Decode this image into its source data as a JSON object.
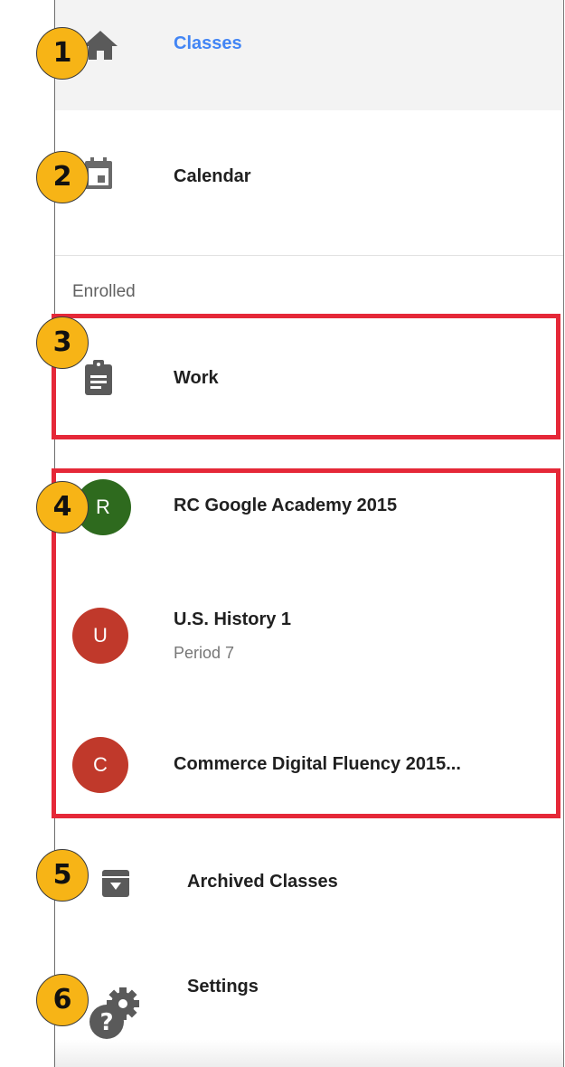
{
  "nav": {
    "classes": "Classes",
    "calendar": "Calendar",
    "section_enrolled": "Enrolled",
    "work": "Work",
    "archived": "Archived Classes",
    "settings": "Settings"
  },
  "classes": [
    {
      "initial": "R",
      "name": "RC Google Academy 2015",
      "subtitle": "",
      "color": "#2e6a1e"
    },
    {
      "initial": "U",
      "name": "U.S. History 1",
      "subtitle": "Period 7",
      "color": "#c0392b"
    },
    {
      "initial": "C",
      "name": "Commerce Digital Fluency 2015...",
      "subtitle": "",
      "color": "#c0392b"
    }
  ],
  "callouts": [
    "1",
    "2",
    "3",
    "4",
    "5",
    "6"
  ],
  "colors": {
    "accent": "#4285f4",
    "highlight_box": "#e52838",
    "callout": "#f7b416",
    "icon": "#5f6368"
  },
  "icons": {
    "classes": "home-icon",
    "calendar": "calendar-icon",
    "work": "clipboard-icon",
    "archived": "archive-icon",
    "settings": "settings-help-icon"
  }
}
